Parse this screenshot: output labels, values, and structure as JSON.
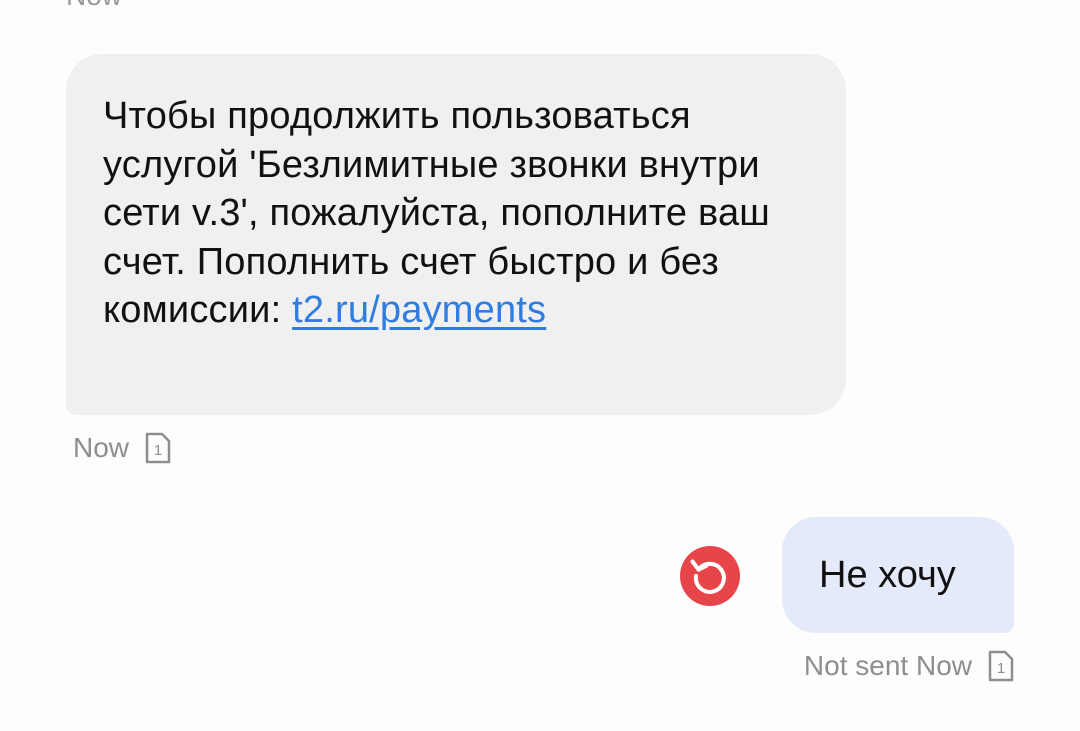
{
  "previous_message": {
    "meta_text": "Now"
  },
  "incoming_message": {
    "text": "Чтобы продолжить пользоваться услугой 'Безлимитные звонки внутри сети v.3', пожалуйста, пополните ваш счет. Пополнить счет быстро и без комиссии: ",
    "link_text": "t2.ru/payments",
    "timestamp": "Now",
    "sim_label": "1"
  },
  "outgoing_message": {
    "text": "Не хочу",
    "status": "Not sent Now",
    "sim_label": "1",
    "resend_icon": "retry-icon",
    "resend_color": "#e8454a"
  },
  "colors": {
    "incoming_bubble": "#f0f0f0",
    "outgoing_bubble": "#e5eafb",
    "link": "#2f7de1",
    "meta": "#8e8e8e"
  }
}
